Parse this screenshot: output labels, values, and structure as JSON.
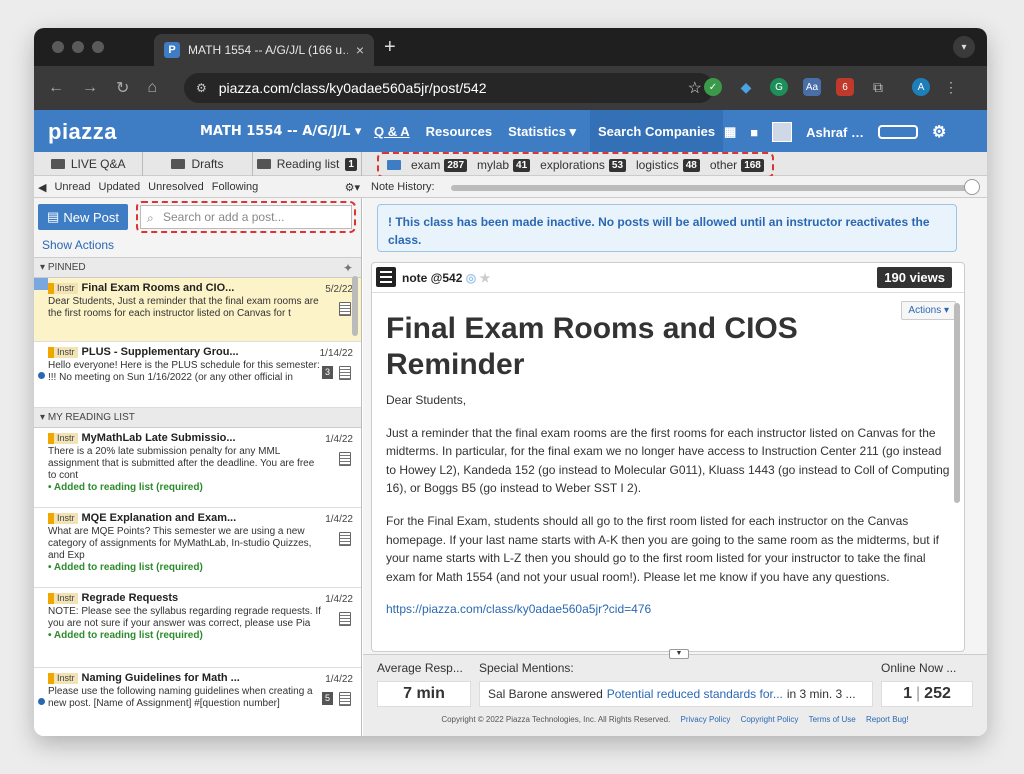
{
  "browser": {
    "tab_title": "MATH 1554 -- A/G/J/L (166 u…",
    "tab_favicon": "P",
    "new_tab": "+",
    "url": "piazza.com/class/ky0adae560a5jr/post/542",
    "ext_badge": "6",
    "profile_initial": "A"
  },
  "header": {
    "logo": "piazza",
    "course": "MATH 1554 -- A/G/J/L ▾",
    "nav": [
      "Q & A",
      "Resources",
      "Statistics ▾"
    ],
    "search_companies": "Search Companies",
    "user": "Ashraf …"
  },
  "subbar": {
    "live": "LIVE Q&A",
    "drafts": "Drafts",
    "reading": "Reading list",
    "reading_count": "1",
    "folders": [
      {
        "name": "exam",
        "count": "287"
      },
      {
        "name": "mylab",
        "count": "41"
      },
      {
        "name": "explorations",
        "count": "53"
      },
      {
        "name": "logistics",
        "count": "48"
      },
      {
        "name": "other",
        "count": "168"
      }
    ]
  },
  "filters": {
    "items": [
      "Unread",
      "Updated",
      "Unresolved",
      "Following"
    ],
    "note_history": "Note History:"
  },
  "left": {
    "new_post": "New Post",
    "search_placeholder": "Search or add a post...",
    "show_actions": "Show Actions",
    "pinned_label": "PINNED",
    "reading_label": "MY READING LIST",
    "instr": "Instr",
    "pinned": [
      {
        "title": "Final Exam Rooms and CIO...",
        "date": "5/2/22",
        "snippet": "Dear Students, Just a reminder that the final exam rooms are the first rooms for each instructor listed on Canvas for t"
      },
      {
        "title": "PLUS - Supplementary Grou...",
        "date": "1/14/22",
        "snippet": "Hello everyone! Here is the PLUS schedule for this semester: !!! No meeting on Sun 1/16/2022 (or any other official in",
        "count": "3"
      }
    ],
    "reading": [
      {
        "title": "MyMathLab Late Submissio...",
        "date": "1/4/22",
        "snippet": "There is a 20% late submission penalty for any MML assignment that is submitted after the deadline. You are free to cont",
        "added": "• Added to reading list (required)"
      },
      {
        "title": "MQE Explanation and Exam...",
        "date": "1/4/22",
        "snippet": "What are MQE Points? This semester we are using a new category of assignments for MyMathLab, In-studio Quizzes, and Exp",
        "added": "• Added to reading list (required)"
      },
      {
        "title": "Regrade Requests",
        "date": "1/4/22",
        "snippet": "NOTE: Please see the syllabus regarding regrade requests. If you are not sure if your answer was correct, please use Pia",
        "added": "• Added to reading list (required)"
      },
      {
        "title": "Naming Guidelines for Math ...",
        "date": "1/4/22",
        "snippet": "Please use the following naming guidelines when creating a new post. [Name of Assignment] #[question number]",
        "count": "5"
      }
    ]
  },
  "post": {
    "inactive": "! This class has been made inactive. No posts will be allowed until an instructor reactivates the class.",
    "label": "note @542",
    "views": "190 views",
    "actions": "Actions ▾",
    "title": "Final Exam Rooms and CIOS Reminder",
    "p1": "Dear Students,",
    "p2": "Just a reminder that the final exam rooms are the first rooms for each instructor listed on Canvas for the midterms. In particular, for the final exam we no longer have access to Instruction Center 211 (go instead to Howey L2), Kandeda 152 (go instead to Molecular G011), Kluass 1443 (go instead to Coll of Computing 16), or Boggs B5 (go instead to Weber SST I 2).",
    "p3": "For the Final Exam, students should all go to the first room listed for each instructor on the Canvas homepage. If your last name starts with A-K then you are going to the same room as the midterms, but if your name starts with L-Z then you should go to the first room listed for your instructor to take the final exam for Math 1554 (and not your usual room!). Please let me know if you have any questions.",
    "link": "https://piazza.com/class/ky0adae560a5jr?cid=476"
  },
  "footer": {
    "avg_label": "Average Resp...",
    "avg_value": "7 min",
    "mentions_label": "Special Mentions:",
    "mention_user": "Sal Barone answered",
    "mention_link": "Potential reduced standards for...",
    "mention_time": "in 3 min. 3 ...",
    "online_label": "Online Now",
    "online_more": "...",
    "online_value": "1",
    "online_total": "252",
    "copyright": "Copyright © 2022 Piazza Technologies, Inc. All Rights Reserved.",
    "links": [
      "Privacy Policy",
      "Copyright Policy",
      "Terms of Use",
      "Report Bug!"
    ]
  }
}
